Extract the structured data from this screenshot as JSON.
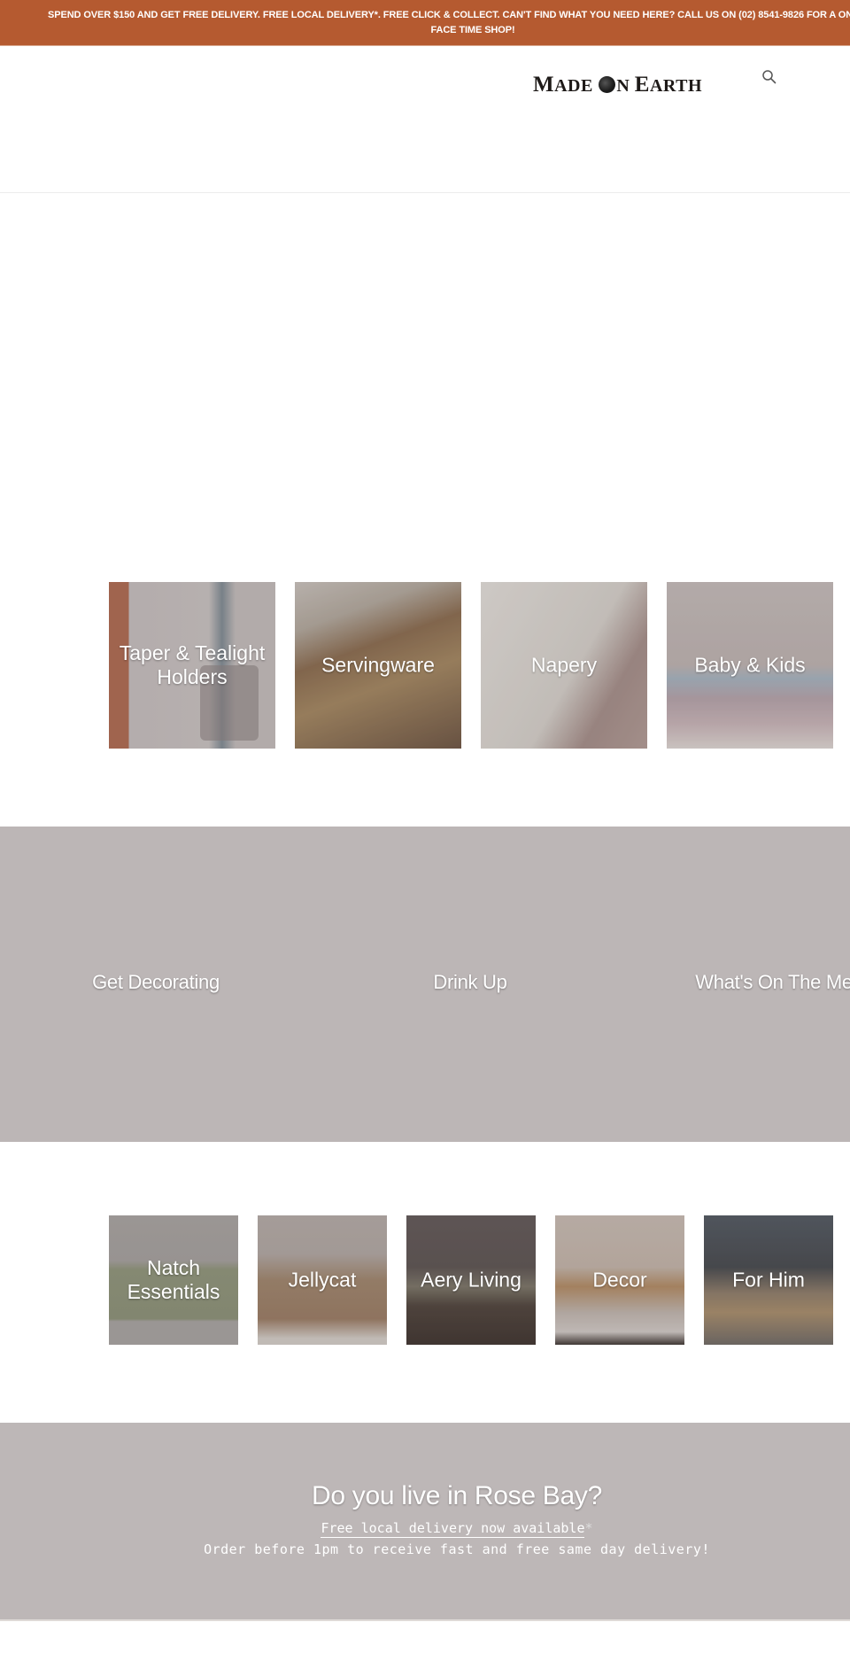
{
  "announcement": {
    "line1": "SPEND OVER $150 AND GET FREE DELIVERY. FREE LOCAL DELIVERY*. FREE CLICK & COLLECT. CAN'T FIND WHAT YOU NEED HERE? CALL US ON (02) 8541-9826 FOR A ONE ON ONE",
    "line2": "FACE TIME SHOP!",
    "color": "#b55a30"
  },
  "header": {
    "logo": {
      "part1_big": "M",
      "part1": "ADE ",
      "part2": "N ",
      "part3_big": "E",
      "part3": "ARTH"
    },
    "search_icon": "search-icon"
  },
  "categories_row1": [
    {
      "label": "Taper & Tealight Holders"
    },
    {
      "label": "Servingware"
    },
    {
      "label": "Napery"
    },
    {
      "label": "Baby & Kids"
    }
  ],
  "feature_links": [
    {
      "label": "Get Decorating"
    },
    {
      "label": "Drink Up"
    },
    {
      "label": "What's On The Menu"
    }
  ],
  "categories_row2": [
    {
      "label": "Natch Essentials"
    },
    {
      "label": "Jellycat"
    },
    {
      "label": "Aery Living"
    },
    {
      "label": "Decor"
    },
    {
      "label": "For Him"
    }
  ],
  "rosebay": {
    "title": "Do you live in Rose Bay?",
    "link": "Free local delivery now available",
    "star": "*",
    "order": "Order before 1pm to receive fast and free same day delivery!"
  }
}
